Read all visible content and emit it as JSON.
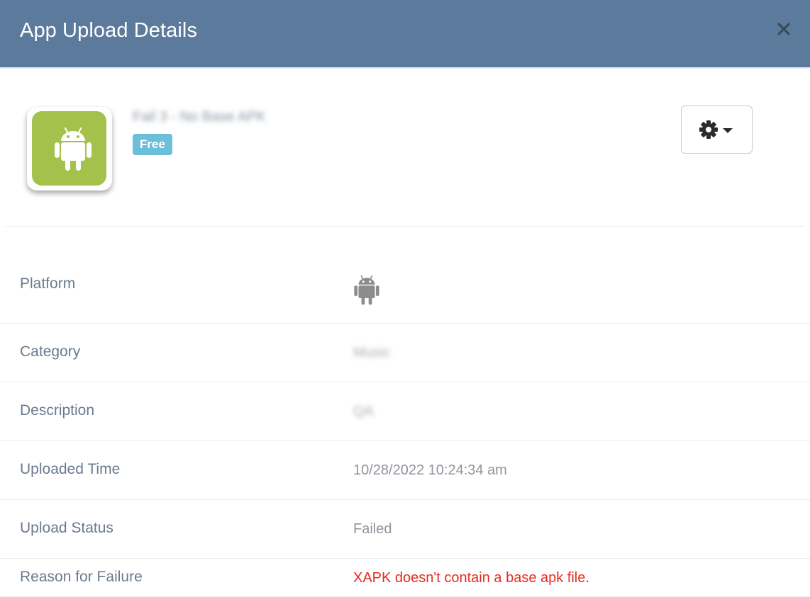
{
  "header": {
    "title": "App Upload Details",
    "close_icon": "close-icon"
  },
  "app": {
    "name": "Fail 3 - No Base APK",
    "price_badge": "Free",
    "icon": "android-icon",
    "icon_color": "#a4c14b",
    "settings_icon": "gear-icon"
  },
  "details": {
    "platform": {
      "label": "Platform",
      "icon": "android-icon"
    },
    "category": {
      "label": "Category",
      "value": "Music"
    },
    "description": {
      "label": "Description",
      "value": "QA"
    },
    "uploaded_time": {
      "label": "Uploaded Time",
      "value": "10/28/2022 10:24:34 am"
    },
    "upload_status": {
      "label": "Upload Status",
      "value": "Failed"
    },
    "failure_reason": {
      "label": "Reason for Failure",
      "value": "XAPK doesn't contain a base apk file."
    }
  },
  "colors": {
    "header_bg": "#5b7a9c",
    "badge_bg": "#6bbfd9",
    "error_text": "#e52b21"
  }
}
